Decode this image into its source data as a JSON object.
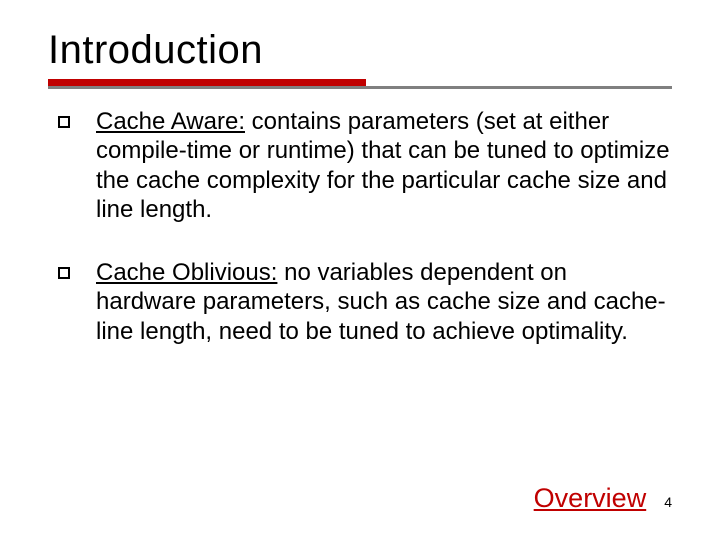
{
  "slide": {
    "title": "Introduction",
    "bullets": [
      {
        "term": "Cache Aware:",
        "rest": " contains parameters (set at either compile-time or runtime) that can be tuned to optimize the cache complexity for the particular cache size and line length."
      },
      {
        "term": "Cache Oblivious:",
        "rest": " no variables dependent on hardware parameters, such as cache size and cache-line length, need to be tuned to achieve optimality."
      }
    ],
    "footer": {
      "link_label": "Overview",
      "page_number": "4"
    },
    "colors": {
      "accent": "#c00000",
      "rule_gray": "#808080"
    }
  }
}
